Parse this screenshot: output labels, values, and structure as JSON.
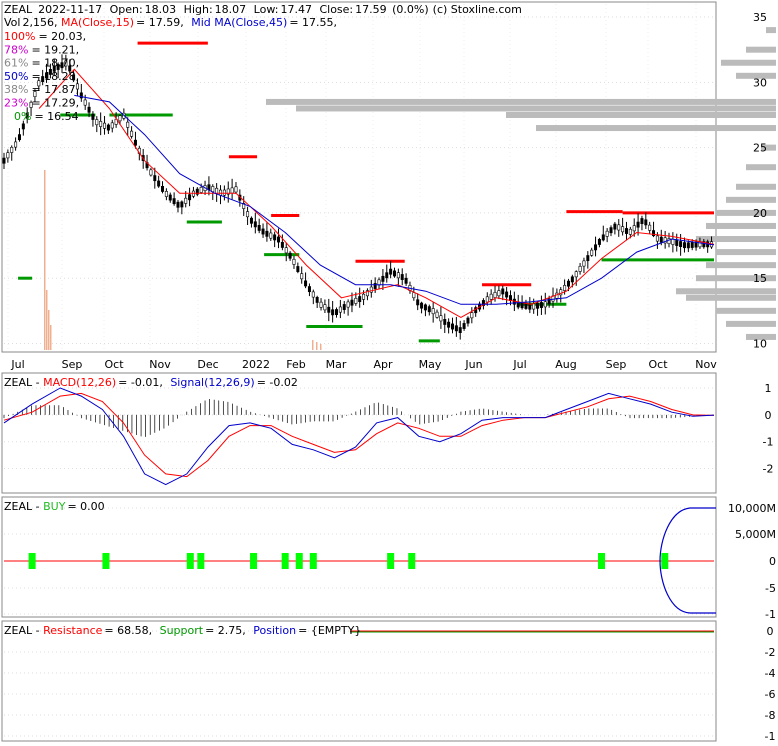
{
  "header": {
    "ticker": "ZEAL",
    "date": "2022-11-17",
    "open_label": "Open:",
    "open": "18.03",
    "high_label": "High:",
    "high": "18.07",
    "low_label": "Low:",
    "low": "17.47",
    "close_label": "Close:",
    "close": "17.59",
    "change": "(0.0%)",
    "source": "(c) Stoxline.com",
    "vol_label": "Vol",
    "vol": "2,156",
    "ma_label": "MA(Close,15)",
    "ma_value": "= 17.59,",
    "mid_ma_label": "Mid MA(Close,45)",
    "mid_ma_value": "= 17.55,"
  },
  "fib_levels": [
    {
      "pct": "100%",
      "value": "= 20.03,",
      "color": "#ff0000"
    },
    {
      "pct": "78%",
      "value": "= 19.21,",
      "color": "#cc00cc"
    },
    {
      "pct": "61%",
      "value": "= 18.70,",
      "color": "#888888"
    },
    {
      "pct": "50%",
      "value": "= 18.28,",
      "color": "#0000cc"
    },
    {
      "pct": "38%",
      "value": "= 17.87,",
      "color": "#888888"
    },
    {
      "pct": "23%",
      "value": "= 17.29,",
      "color": "#cc00cc"
    },
    {
      "pct": "0%",
      "value": "= 16.54",
      "color": "#009900"
    }
  ],
  "macd_header": {
    "ticker": "ZEAL",
    "macd_label": "MACD(12,26)",
    "macd_value": "= -0.01,",
    "signal_label": "Signal(12,26,9)",
    "signal_value": "= -0.02"
  },
  "buy_header": {
    "ticker": "ZEAL",
    "buy_label": "BUY",
    "buy_value": "= 0.00"
  },
  "rs_header": {
    "ticker": "ZEAL",
    "resistance_label": "Resistance",
    "resistance_value": "= 68.58,",
    "support_label": "Support",
    "support_value": "= 2.75,",
    "position_label": "Position",
    "position_value": "= {EMPTY}"
  },
  "colors": {
    "up": "#009900",
    "down": "#ff0000",
    "ma15": "#ff0000",
    "ma45": "#0000cc",
    "macd": "#0000cc",
    "signal": "#ff0000",
    "buy_marker": "#00ff00",
    "histogram": "#000000",
    "volume_profile": "#bbbbbb",
    "volume_bars": "#f0b090"
  },
  "chart_data": [
    {
      "type": "candlestick",
      "x_ticks": [
        "Jul",
        "Sep",
        "Oct",
        "Nov",
        "Dec",
        "2022",
        "Feb",
        "Mar",
        "Apr",
        "May",
        "Jun",
        "Jul",
        "Aug",
        "Sep",
        "Oct",
        "Nov"
      ],
      "y_ticks": [
        10,
        15,
        20,
        25,
        30,
        35
      ],
      "ylim": [
        9.5,
        36
      ],
      "price": [
        [
          0,
          24
        ],
        [
          4,
          25.5
        ],
        [
          10,
          30
        ],
        [
          14,
          31
        ],
        [
          18,
          31.5
        ],
        [
          22,
          29
        ],
        [
          26,
          27
        ],
        [
          30,
          26.5
        ],
        [
          34,
          27.5
        ],
        [
          38,
          25
        ],
        [
          42,
          23
        ],
        [
          46,
          21.5
        ],
        [
          50,
          20.5
        ],
        [
          54,
          21.5
        ],
        [
          58,
          22
        ],
        [
          62,
          21.5
        ],
        [
          66,
          21.8
        ],
        [
          70,
          19.5
        ],
        [
          74,
          18.5
        ],
        [
          78,
          18
        ],
        [
          82,
          16.5
        ],
        [
          86,
          14.5
        ],
        [
          90,
          13
        ],
        [
          94,
          12.3
        ],
        [
          98,
          13
        ],
        [
          102,
          13.5
        ],
        [
          106,
          14.5
        ],
        [
          110,
          15.5
        ],
        [
          114,
          15
        ],
        [
          118,
          13
        ],
        [
          122,
          12.5
        ],
        [
          126,
          11.5
        ],
        [
          130,
          11
        ],
        [
          134,
          12.5
        ],
        [
          138,
          13.5
        ],
        [
          142,
          14
        ],
        [
          146,
          13
        ],
        [
          150,
          12.8
        ],
        [
          154,
          13
        ],
        [
          158,
          13.8
        ],
        [
          162,
          15
        ],
        [
          166,
          16.5
        ],
        [
          170,
          18
        ],
        [
          174,
          19
        ],
        [
          178,
          18.5
        ],
        [
          182,
          19.5
        ],
        [
          186,
          18
        ],
        [
          190,
          17.8
        ],
        [
          194,
          17.5
        ],
        [
          198,
          17.6
        ],
        [
          202,
          17.59
        ]
      ],
      "ma15": [
        [
          10,
          28
        ],
        [
          20,
          31
        ],
        [
          30,
          28
        ],
        [
          40,
          24
        ],
        [
          50,
          21.5
        ],
        [
          60,
          21.5
        ],
        [
          66,
          21.5
        ],
        [
          76,
          19
        ],
        [
          86,
          16
        ],
        [
          96,
          13.5
        ],
        [
          104,
          14
        ],
        [
          112,
          14.5
        ],
        [
          120,
          13.5
        ],
        [
          130,
          12
        ],
        [
          140,
          13.5
        ],
        [
          150,
          13
        ],
        [
          160,
          14
        ],
        [
          170,
          16.5
        ],
        [
          180,
          18.5
        ],
        [
          190,
          18.2
        ],
        [
          202,
          17.59
        ]
      ],
      "ma45": [
        [
          20,
          29
        ],
        [
          30,
          28.5
        ],
        [
          40,
          26
        ],
        [
          50,
          23
        ],
        [
          60,
          21.5
        ],
        [
          70,
          20.5
        ],
        [
          80,
          18.5
        ],
        [
          90,
          16
        ],
        [
          100,
          14.5
        ],
        [
          110,
          14.5
        ],
        [
          120,
          14
        ],
        [
          130,
          13
        ],
        [
          140,
          13
        ],
        [
          150,
          13.2
        ],
        [
          160,
          13.5
        ],
        [
          170,
          15
        ],
        [
          180,
          17
        ],
        [
          190,
          18
        ],
        [
          202,
          17.55
        ]
      ],
      "resistance_levels": [
        {
          "from": 38,
          "to": 58,
          "value": 33
        },
        {
          "from": 64,
          "to": 72,
          "value": 24.3
        },
        {
          "from": 76,
          "to": 84,
          "value": 19.8
        },
        {
          "from": 100,
          "to": 114,
          "value": 16.3
        },
        {
          "from": 136,
          "to": 150,
          "value": 14.5
        },
        {
          "from": 160,
          "to": 176,
          "value": 20.1
        },
        {
          "from": 176,
          "to": 202,
          "value": 20
        }
      ],
      "support_levels": [
        {
          "from": 4,
          "to": 8,
          "value": 15
        },
        {
          "from": 16,
          "to": 26,
          "value": 27.5
        },
        {
          "from": 30,
          "to": 48,
          "value": 27.5
        },
        {
          "from": 52,
          "to": 62,
          "value": 19.3
        },
        {
          "from": 74,
          "to": 84,
          "value": 16.8
        },
        {
          "from": 86,
          "to": 102,
          "value": 11.3
        },
        {
          "from": 118,
          "to": 124,
          "value": 10.2
        },
        {
          "from": 146,
          "to": 160,
          "value": 13
        },
        {
          "from": 170,
          "to": 202,
          "value": 16.4
        }
      ]
    },
    {
      "type": "line",
      "name": "MACD",
      "y_ticks": [
        1,
        0,
        -1,
        -2
      ],
      "ylim": [
        -2.8,
        1.3
      ],
      "macd": [
        [
          0,
          -0.3
        ],
        [
          8,
          0.4
        ],
        [
          16,
          1.0
        ],
        [
          22,
          0.7
        ],
        [
          28,
          0.2
        ],
        [
          34,
          -0.8
        ],
        [
          40,
          -2.2
        ],
        [
          46,
          -2.6
        ],
        [
          52,
          -2.2
        ],
        [
          58,
          -1.2
        ],
        [
          64,
          -0.4
        ],
        [
          70,
          -0.3
        ],
        [
          76,
          -0.5
        ],
        [
          82,
          -1.1
        ],
        [
          88,
          -1.3
        ],
        [
          94,
          -1.6
        ],
        [
          100,
          -1.2
        ],
        [
          106,
          -0.3
        ],
        [
          112,
          -0.1
        ],
        [
          118,
          -0.8
        ],
        [
          124,
          -1.0
        ],
        [
          130,
          -0.7
        ],
        [
          136,
          -0.2
        ],
        [
          142,
          -0.1
        ],
        [
          148,
          -0.1
        ],
        [
          154,
          -0.1
        ],
        [
          160,
          0.2
        ],
        [
          166,
          0.5
        ],
        [
          172,
          0.8
        ],
        [
          178,
          0.6
        ],
        [
          184,
          0.4
        ],
        [
          190,
          0.1
        ],
        [
          196,
          -0.05
        ],
        [
          202,
          -0.01
        ]
      ],
      "signal": [
        [
          0,
          -0.2
        ],
        [
          8,
          0.1
        ],
        [
          16,
          0.7
        ],
        [
          22,
          0.8
        ],
        [
          28,
          0.5
        ],
        [
          34,
          -0.3
        ],
        [
          40,
          -1.5
        ],
        [
          46,
          -2.2
        ],
        [
          52,
          -2.3
        ],
        [
          58,
          -1.7
        ],
        [
          64,
          -0.8
        ],
        [
          70,
          -0.4
        ],
        [
          76,
          -0.4
        ],
        [
          82,
          -0.8
        ],
        [
          88,
          -1.1
        ],
        [
          94,
          -1.4
        ],
        [
          100,
          -1.3
        ],
        [
          106,
          -0.7
        ],
        [
          112,
          -0.3
        ],
        [
          118,
          -0.5
        ],
        [
          124,
          -0.8
        ],
        [
          130,
          -0.8
        ],
        [
          136,
          -0.4
        ],
        [
          142,
          -0.2
        ],
        [
          148,
          -0.1
        ],
        [
          154,
          -0.1
        ],
        [
          160,
          0.1
        ],
        [
          166,
          0.3
        ],
        [
          172,
          0.6
        ],
        [
          178,
          0.7
        ],
        [
          184,
          0.5
        ],
        [
          190,
          0.2
        ],
        [
          196,
          0.0
        ],
        [
          202,
          -0.02
        ]
      ]
    },
    {
      "type": "line",
      "name": "BUY",
      "y_ticks": [
        "10,000M",
        "5,000M",
        "0",
        "-5",
        "-1"
      ],
      "buy_markers_x": [
        8,
        29,
        53,
        56,
        71,
        80,
        84,
        88,
        110,
        116,
        170,
        188
      ]
    },
    {
      "type": "line",
      "name": "Resistance/Support/Position",
      "y_ticks": [
        "0",
        "-2",
        "-4",
        "-6",
        "-8",
        "-1"
      ]
    }
  ]
}
